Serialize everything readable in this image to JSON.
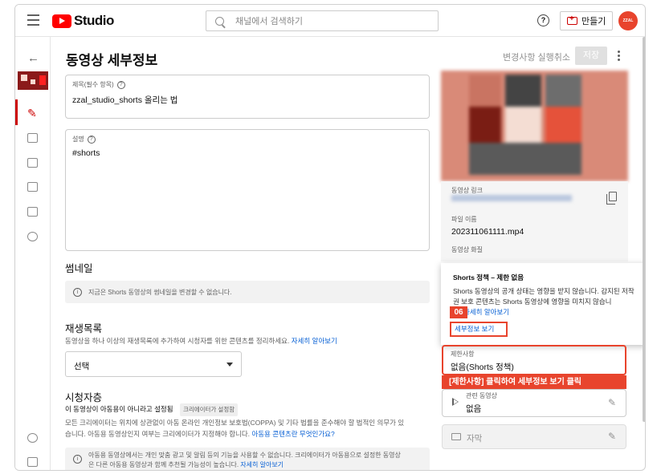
{
  "header": {
    "logo_text": "Studio",
    "search_placeholder": "채널에서 검색하기",
    "help_glyph": "?",
    "create_label": "만들기",
    "avatar_text": "ZZAL"
  },
  "page": {
    "title": "동영상 세부정보",
    "undo_label": "변경사항 실행취소",
    "save_label": "저장"
  },
  "form": {
    "title_label": "제목(필수 항목)",
    "title_value": "zzal_studio_shorts 올리는 법",
    "desc_label": "설명",
    "desc_value": "#shorts",
    "thumbnail_heading": "썸네일",
    "thumbnail_note": "지금은 Shorts 동영상의 썸네일을 변경할 수 없습니다.",
    "playlist_heading": "재생목록",
    "playlist_desc": "동영상을 하나 이상의 재생목록에 추가하여 시청자를 위한 콘텐츠를 정리하세요.",
    "playlist_link": "자세히 알아보기",
    "playlist_select": "선택",
    "audience_heading": "시청자층",
    "audience_status": "이 동영상이 아동용이 아니라고 설정됨",
    "audience_chip": "크리에이터가 설정함",
    "audience_desc_1": "모든 크리에이터는 위치에 상관없이 아동 온라인 개인정보 보호법(COPPA) 및 기타 법률을 준수해야 할 법적인 의무가 있",
    "audience_desc_2": "습니다. 아동용 동영상인지 여부는 크리에이터가 지정해야 합니다.",
    "audience_link": "아동용 콘텐츠란 무엇인가요?",
    "audience_note_1": "아동용 동영상에서는 개인 맞춤 광고 및 알림 등의 기능을 사용할 수 없습니다. 크리에이터가 아동용으로 설정한 동영상",
    "audience_note_2": "은 다른 아동용 동영상과 함께 추천될 가능성이 높습니다.",
    "audience_note_link": "자세히 알아보기"
  },
  "side": {
    "video_link_label": "동영상 링크",
    "filename_label": "파일 이름",
    "filename_value": "202311061111.mp4",
    "quality_label": "동영상 화질",
    "popup_title": "Shorts 정책 – 제한 없음",
    "popup_body": "Shorts 동영상의 공개 상태는 영향을 받지 않습니다. 감지된 저작권 보호 콘텐츠는 Shorts 동영상에 영향을 미치지 않습니",
    "popup_link": "자세히 알아보기",
    "step_badge": "06",
    "details_button": "세부정보 보기",
    "restriction_label": "제한사항",
    "restriction_value": "없음(Shorts 정책)",
    "banner_text": "[제한사항] 클릭하여 세부정보 보기 클릭",
    "related_label": "관련 동영상",
    "related_value": "없음",
    "subtitles_label": "자막"
  },
  "colors": {
    "accent": "#e8442d",
    "brand_red": "#ff0000",
    "link": "#065fd4"
  }
}
